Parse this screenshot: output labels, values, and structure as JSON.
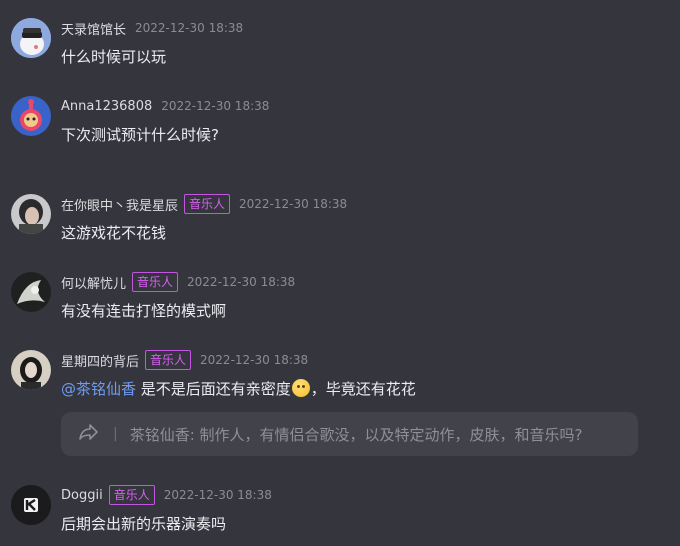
{
  "messages": [
    {
      "user": "天录馆馆长",
      "time": "2022-12-30 18:38",
      "text": "什么时候可以玩"
    },
    {
      "user": "Anna1236808",
      "time": "2022-12-30 18:38",
      "text": "下次测试预计什么时候?"
    },
    {
      "user": "在你眼中丶我是星辰",
      "badge": "音乐人",
      "time": "2022-12-30 18:38",
      "text": "这游戏花不花钱"
    },
    {
      "user": "何以解忧儿",
      "badge": "音乐人",
      "time": "2022-12-30 18:38",
      "text": "有没有连击打怪的模式啊"
    },
    {
      "user": "星期四的背后",
      "badge": "音乐人",
      "time": "2022-12-30 18:38",
      "mention": "@茶铭仙香",
      "text_before_emoji": " 是不是后面还有亲密度",
      "text_after_emoji": "，毕竟还有花花",
      "quote": {
        "separator": "|",
        "text": "茶铭仙香: 制作人，有情侣合歌没，以及特定动作，皮肤，和音乐吗?"
      }
    },
    {
      "user": "Doggii",
      "badge": "音乐人",
      "time": "2022-12-30 18:38",
      "text": "后期会出新的乐器演奏吗"
    }
  ],
  "icons": {
    "reply": "reply-arrow-icon",
    "emoji": "thinking-face-emoji",
    "avatar_logo": "k-logo-icon"
  },
  "colors": {
    "background": "#35363d",
    "badge": "#d85ff2",
    "mention": "#6f9cf2",
    "quote_bg": "#41424a"
  }
}
